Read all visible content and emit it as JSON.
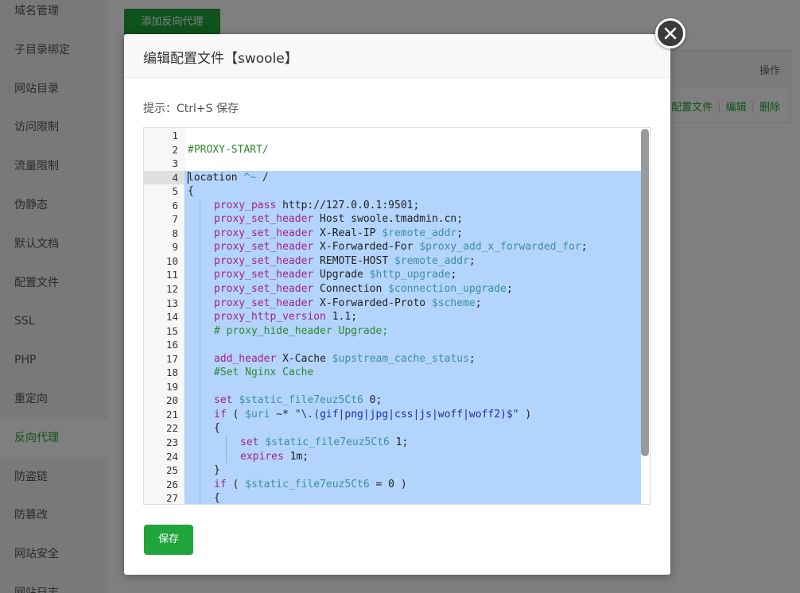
{
  "sidebar": {
    "items": [
      {
        "label": "域名管理"
      },
      {
        "label": "子目录绑定"
      },
      {
        "label": "网站目录"
      },
      {
        "label": "访问限制"
      },
      {
        "label": "流量限制"
      },
      {
        "label": "伪静态"
      },
      {
        "label": "默认文档"
      },
      {
        "label": "配置文件"
      },
      {
        "label": "SSL"
      },
      {
        "label": "PHP"
      },
      {
        "label": "重定向"
      },
      {
        "label": "反向代理"
      },
      {
        "label": "防盗链"
      },
      {
        "label": "防篡改"
      },
      {
        "label": "网站安全"
      },
      {
        "label": "网站日志"
      }
    ],
    "active_index": 11
  },
  "toolbar": {
    "add_proxy_label": "添加反向代理"
  },
  "table": {
    "op_header": "操作",
    "actions": [
      "配置文件",
      "编辑",
      "删除"
    ]
  },
  "modal": {
    "title": "编辑配置文件【swoole】",
    "hint": "提示：Ctrl+S 保存",
    "save_label": "保存"
  },
  "editor": {
    "current_line": 4,
    "selection_start_line": 4,
    "lines": [
      {
        "n": "1",
        "indent": 0,
        "tokens": []
      },
      {
        "n": "2",
        "indent": 0,
        "tokens": [
          {
            "t": "#PROXY-START/",
            "c": "com"
          }
        ]
      },
      {
        "n": "3",
        "indent": 0,
        "tokens": []
      },
      {
        "n": "4",
        "indent": 0,
        "tokens": [
          {
            "t": "location ",
            "c": ""
          },
          {
            "t": "^~",
            "c": "var"
          },
          {
            "t": " /",
            "c": ""
          }
        ]
      },
      {
        "n": "5",
        "indent": 0,
        "tokens": [
          {
            "t": "{",
            "c": ""
          }
        ]
      },
      {
        "n": "6",
        "indent": 1,
        "tokens": [
          {
            "t": "proxy_pass",
            "c": "kw"
          },
          {
            "t": " http://127.0.0.1:9501;",
            "c": ""
          }
        ]
      },
      {
        "n": "7",
        "indent": 1,
        "tokens": [
          {
            "t": "proxy_set_header",
            "c": "kw"
          },
          {
            "t": " Host swoole.tmadmin.cn;",
            "c": ""
          }
        ]
      },
      {
        "n": "8",
        "indent": 1,
        "tokens": [
          {
            "t": "proxy_set_header",
            "c": "kw"
          },
          {
            "t": " X-Real-IP ",
            "c": ""
          },
          {
            "t": "$remote_addr",
            "c": "var"
          },
          {
            "t": ";",
            "c": ""
          }
        ]
      },
      {
        "n": "9",
        "indent": 1,
        "tokens": [
          {
            "t": "proxy_set_header",
            "c": "kw"
          },
          {
            "t": " X-Forwarded-For ",
            "c": ""
          },
          {
            "t": "$proxy_add_x_forwarded_for",
            "c": "var"
          },
          {
            "t": ";",
            "c": ""
          }
        ]
      },
      {
        "n": "10",
        "indent": 1,
        "tokens": [
          {
            "t": "proxy_set_header",
            "c": "kw"
          },
          {
            "t": " REMOTE-HOST ",
            "c": ""
          },
          {
            "t": "$remote_addr",
            "c": "var"
          },
          {
            "t": ";",
            "c": ""
          }
        ]
      },
      {
        "n": "11",
        "indent": 1,
        "tokens": [
          {
            "t": "proxy_set_header",
            "c": "kw"
          },
          {
            "t": " Upgrade ",
            "c": ""
          },
          {
            "t": "$http_upgrade",
            "c": "var"
          },
          {
            "t": ";",
            "c": ""
          }
        ]
      },
      {
        "n": "12",
        "indent": 1,
        "tokens": [
          {
            "t": "proxy_set_header",
            "c": "kw"
          },
          {
            "t": " Connection ",
            "c": ""
          },
          {
            "t": "$connection_upgrade",
            "c": "var"
          },
          {
            "t": ";",
            "c": ""
          }
        ]
      },
      {
        "n": "13",
        "indent": 1,
        "tokens": [
          {
            "t": "proxy_set_header",
            "c": "kw"
          },
          {
            "t": " X-Forwarded-Proto ",
            "c": ""
          },
          {
            "t": "$scheme",
            "c": "var"
          },
          {
            "t": ";",
            "c": ""
          }
        ]
      },
      {
        "n": "14",
        "indent": 1,
        "tokens": [
          {
            "t": "proxy_http_version",
            "c": "kw"
          },
          {
            "t": " 1.1;",
            "c": ""
          }
        ]
      },
      {
        "n": "15",
        "indent": 1,
        "tokens": [
          {
            "t": "# proxy_hide_header Upgrade;",
            "c": "com"
          }
        ]
      },
      {
        "n": "16",
        "indent": 1,
        "tokens": []
      },
      {
        "n": "17",
        "indent": 1,
        "tokens": [
          {
            "t": "add_header",
            "c": "kw"
          },
          {
            "t": " X-Cache ",
            "c": ""
          },
          {
            "t": "$upstream_cache_status",
            "c": "var"
          },
          {
            "t": ";",
            "c": ""
          }
        ]
      },
      {
        "n": "18",
        "indent": 1,
        "tokens": [
          {
            "t": "#Set Nginx Cache",
            "c": "com"
          }
        ]
      },
      {
        "n": "19",
        "indent": 1,
        "tokens": []
      },
      {
        "n": "20",
        "indent": 1,
        "tokens": [
          {
            "t": "set",
            "c": "kw"
          },
          {
            "t": " ",
            "c": ""
          },
          {
            "t": "$static_file7euz5Ct6",
            "c": "var"
          },
          {
            "t": " 0;",
            "c": ""
          }
        ]
      },
      {
        "n": "21",
        "indent": 1,
        "tokens": [
          {
            "t": "if",
            "c": "kw"
          },
          {
            "t": " ( ",
            "c": ""
          },
          {
            "t": "$uri",
            "c": "var"
          },
          {
            "t": " ~* ",
            "c": ""
          },
          {
            "t": "\"\\.(gif|png|jpg|css|js|woff|woff2)$\"",
            "c": "str"
          },
          {
            "t": " )",
            "c": ""
          }
        ]
      },
      {
        "n": "22",
        "indent": 1,
        "tokens": [
          {
            "t": "{",
            "c": ""
          }
        ]
      },
      {
        "n": "23",
        "indent": 2,
        "tokens": [
          {
            "t": "set",
            "c": "kw"
          },
          {
            "t": " ",
            "c": ""
          },
          {
            "t": "$static_file7euz5Ct6",
            "c": "var"
          },
          {
            "t": " 1;",
            "c": ""
          }
        ]
      },
      {
        "n": "24",
        "indent": 2,
        "tokens": [
          {
            "t": "expires",
            "c": "kw"
          },
          {
            "t": " 1m;",
            "c": ""
          }
        ]
      },
      {
        "n": "25",
        "indent": 1,
        "tokens": [
          {
            "t": "}",
            "c": ""
          }
        ]
      },
      {
        "n": "26",
        "indent": 1,
        "tokens": [
          {
            "t": "if",
            "c": "kw"
          },
          {
            "t": " ( ",
            "c": ""
          },
          {
            "t": "$static_file7euz5Ct6",
            "c": "var"
          },
          {
            "t": " = 0 )",
            "c": ""
          }
        ]
      },
      {
        "n": "27",
        "indent": 1,
        "tokens": [
          {
            "t": "{",
            "c": ""
          }
        ]
      }
    ]
  }
}
